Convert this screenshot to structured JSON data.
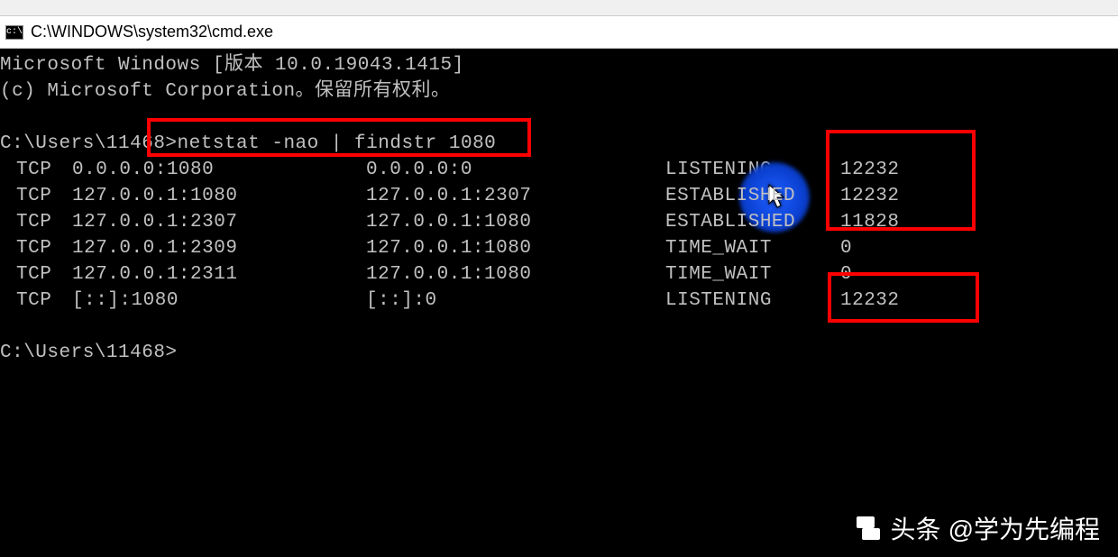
{
  "title_bar": {
    "path": "C:\\WINDOWS\\system32\\cmd.exe"
  },
  "header": {
    "line1": "Microsoft Windows [版本 10.0.19043.1415]",
    "line2": "(c) Microsoft Corporation。保留所有权利。"
  },
  "prompt1": {
    "prefix": "C:\\Users\\11468>",
    "command": "netstat -nao | findstr 1080"
  },
  "rows": [
    {
      "proto": "TCP",
      "local": "0.0.0.0:1080",
      "foreign": "0.0.0.0:0",
      "state": "LISTENING",
      "pid": "12232"
    },
    {
      "proto": "TCP",
      "local": "127.0.0.1:1080",
      "foreign": "127.0.0.1:2307",
      "state": "ESTABLISHED",
      "pid": "12232"
    },
    {
      "proto": "TCP",
      "local": "127.0.0.1:2307",
      "foreign": "127.0.0.1:1080",
      "state": "ESTABLISHED",
      "pid": "11828"
    },
    {
      "proto": "TCP",
      "local": "127.0.0.1:2309",
      "foreign": "127.0.0.1:1080",
      "state": "TIME_WAIT",
      "pid": "0"
    },
    {
      "proto": "TCP",
      "local": "127.0.0.1:2311",
      "foreign": "127.0.0.1:1080",
      "state": "TIME_WAIT",
      "pid": "0"
    },
    {
      "proto": "TCP",
      "local": "[::]:1080",
      "foreign": "[::]:0",
      "state": "LISTENING",
      "pid": "12232"
    }
  ],
  "prompt2": {
    "prefix": "C:\\Users\\11468>"
  },
  "watermark": {
    "brand": "头条",
    "handle": "@学为先编程"
  }
}
